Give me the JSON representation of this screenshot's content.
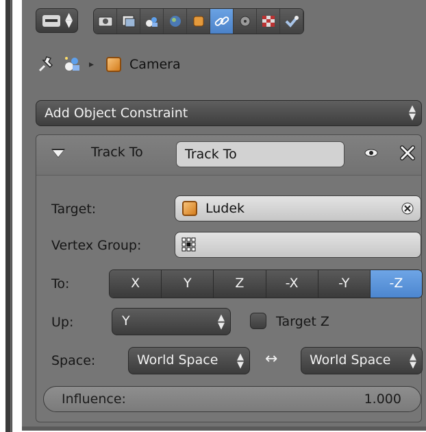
{
  "header": {
    "editor_type_icon": "properties-editor-icon",
    "tabs": [
      {
        "icon": "render-icon",
        "active": false
      },
      {
        "icon": "render-layers-icon",
        "active": false
      },
      {
        "icon": "scene-icon",
        "active": false
      },
      {
        "icon": "world-icon",
        "active": false
      },
      {
        "icon": "object-icon",
        "active": false
      },
      {
        "icon": "object-constraints-icon",
        "active": true
      },
      {
        "icon": "modifiers-icon",
        "active": false
      },
      {
        "icon": "texture-icon",
        "active": false
      },
      {
        "icon": "physics-icon",
        "active": false
      }
    ]
  },
  "breadcrumb": {
    "object_name": "Camera"
  },
  "add_constraint": {
    "label": "Add Object Constraint"
  },
  "constraint": {
    "type_label": "Track To",
    "name_value": "Track To",
    "target_label": "Target:",
    "target_value": "Ludek",
    "vertex_group_label": "Vertex Group:",
    "vertex_group_value": "",
    "to_label": "To:",
    "axes": [
      "X",
      "Y",
      "Z",
      "-X",
      "-Y",
      "-Z"
    ],
    "axis_selected": "-Z",
    "up_label": "Up:",
    "up_value": "Y",
    "target_z_label": "Target Z",
    "target_z_checked": false,
    "space_label": "Space:",
    "owner_space": "World Space",
    "swap_symbol": "↔",
    "target_space": "World Space",
    "influence_label": "Influence:",
    "influence_value": "1.000"
  },
  "colors": {
    "panel_bg": "#727272",
    "active_accent": "#5b93d8"
  }
}
